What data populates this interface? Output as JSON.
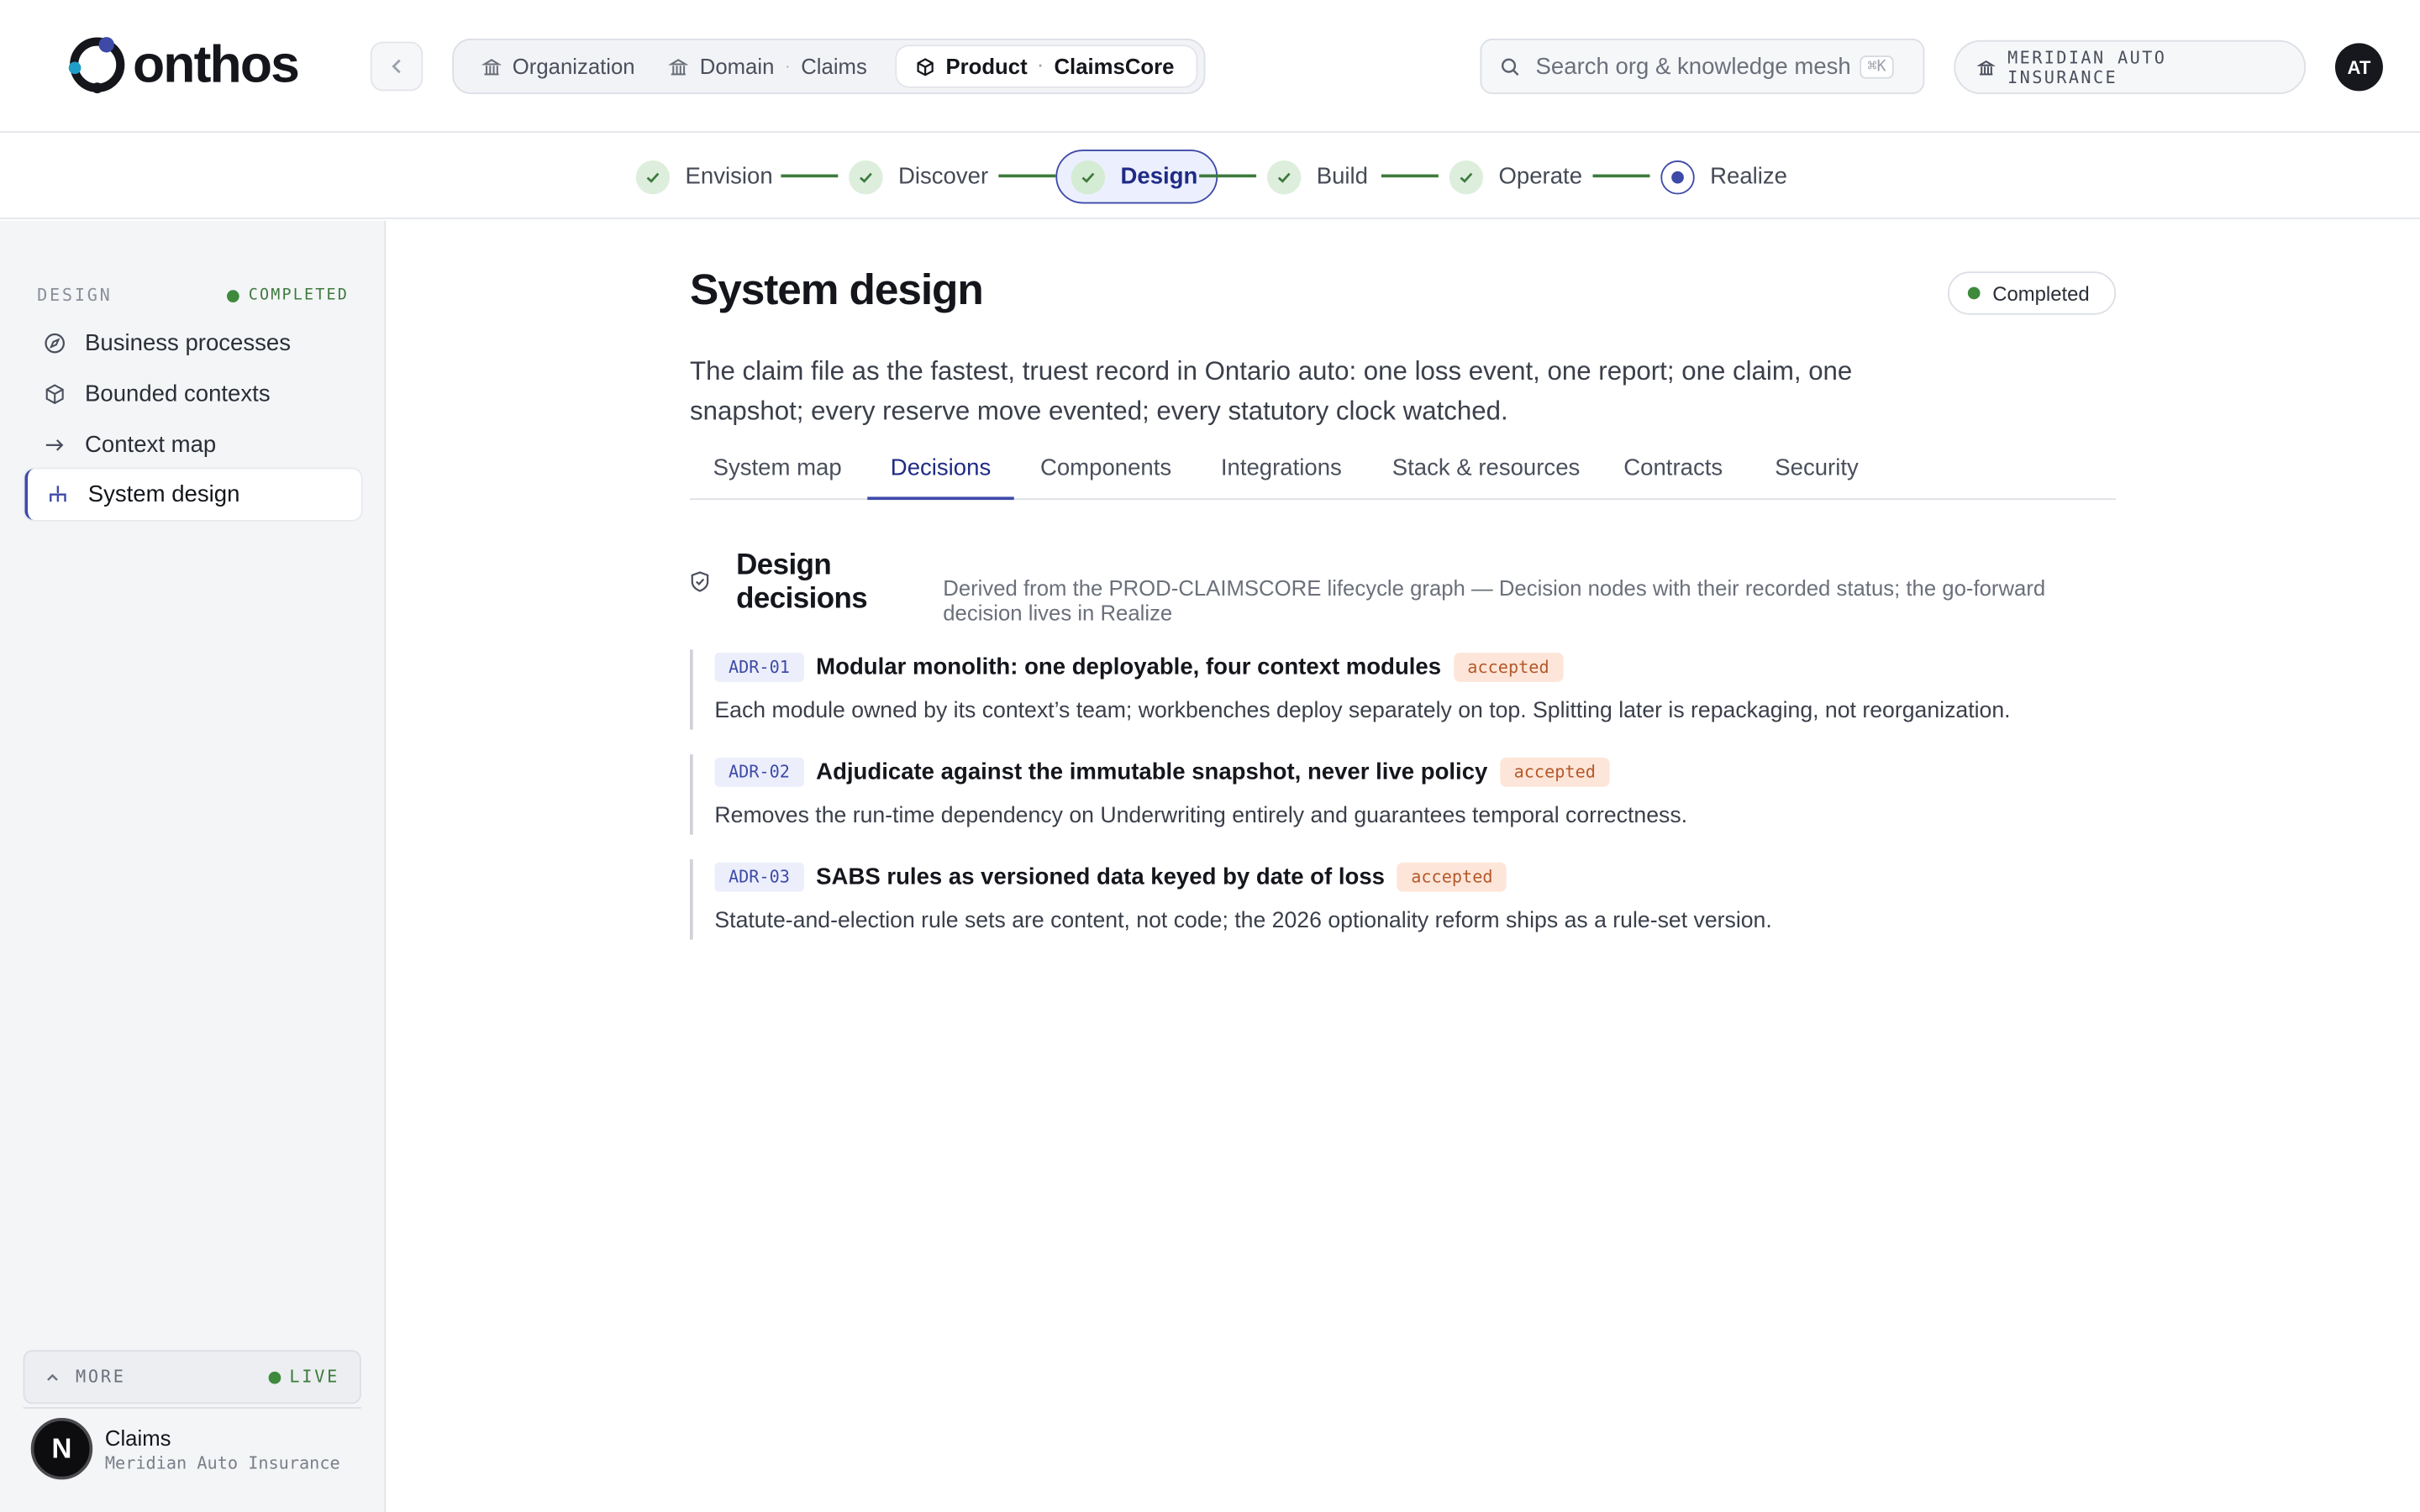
{
  "brand": {
    "name": "onthos"
  },
  "breadcrumbs": [
    {
      "label": "Organization",
      "value": ""
    },
    {
      "label": "Domain",
      "value": "Claims"
    },
    {
      "label": "Product",
      "value": "ClaimsCore"
    }
  ],
  "search": {
    "placeholder": "Search org & knowledge mesh",
    "shortcut": "⌘K"
  },
  "org": {
    "name": "MERIDIAN AUTO INSURANCE"
  },
  "user": {
    "initials": "AT"
  },
  "stepper": {
    "steps": [
      {
        "label": "Envision",
        "state": "done"
      },
      {
        "label": "Discover",
        "state": "done"
      },
      {
        "label": "Design",
        "state": "current"
      },
      {
        "label": "Build",
        "state": "done"
      },
      {
        "label": "Operate",
        "state": "done"
      },
      {
        "label": "Realize",
        "state": "active"
      }
    ]
  },
  "sidebar": {
    "section_label": "DESIGN",
    "section_status": "COMPLETED",
    "items": [
      {
        "label": "Business processes",
        "icon": "compass-icon"
      },
      {
        "label": "Bounded contexts",
        "icon": "cube-icon"
      },
      {
        "label": "Context map",
        "icon": "arrow-right-icon"
      },
      {
        "label": "System design",
        "icon": "hierarchy-icon",
        "active": true
      }
    ],
    "more_label": "MORE",
    "live_label": "LIVE",
    "workspace": {
      "logo": "N",
      "name": "Claims",
      "org": "Meridian Auto Insurance"
    }
  },
  "main": {
    "title": "System design",
    "status": "Completed",
    "summary": "The claim file as the fastest, truest record in Ontario auto: one loss event, one report; one claim, one snapshot; every reserve move evented; every statutory clock watched.",
    "tabs": [
      "System map",
      "Decisions",
      "Components",
      "Integrations",
      "Stack & resources",
      "Contracts",
      "Security"
    ],
    "active_tab": "Decisions",
    "section": {
      "title_line1": "Design",
      "title_line2": "decisions",
      "description": "Derived from the PROD-CLAIMSCORE lifecycle graph — Decision nodes with their recorded status; the go-forward decision lives in Realize"
    },
    "decisions": [
      {
        "id": "ADR-01",
        "title": "Modular monolith: one deployable, four context modules",
        "status": "accepted",
        "body": "Each module owned by its context’s team; workbenches deploy separately on top. Splitting later is repackaging, not reorganization."
      },
      {
        "id": "ADR-02",
        "title": "Adjudicate against the immutable snapshot, never live policy",
        "status": "accepted",
        "body": "Removes the run-time dependency on Underwriting entirely and guarantees temporal correctness."
      },
      {
        "id": "ADR-03",
        "title": "SABS rules as versioned data keyed by date of loss",
        "status": "accepted",
        "body": "Statute-and-election rule sets are content, not code; the 2026 optionality reform ships as a rule-set version."
      }
    ]
  },
  "colors": {
    "accent": "#3e4aa8",
    "success": "#3d8a3d",
    "status_bg": "#fde6d9",
    "status_text": "#b5592b"
  }
}
